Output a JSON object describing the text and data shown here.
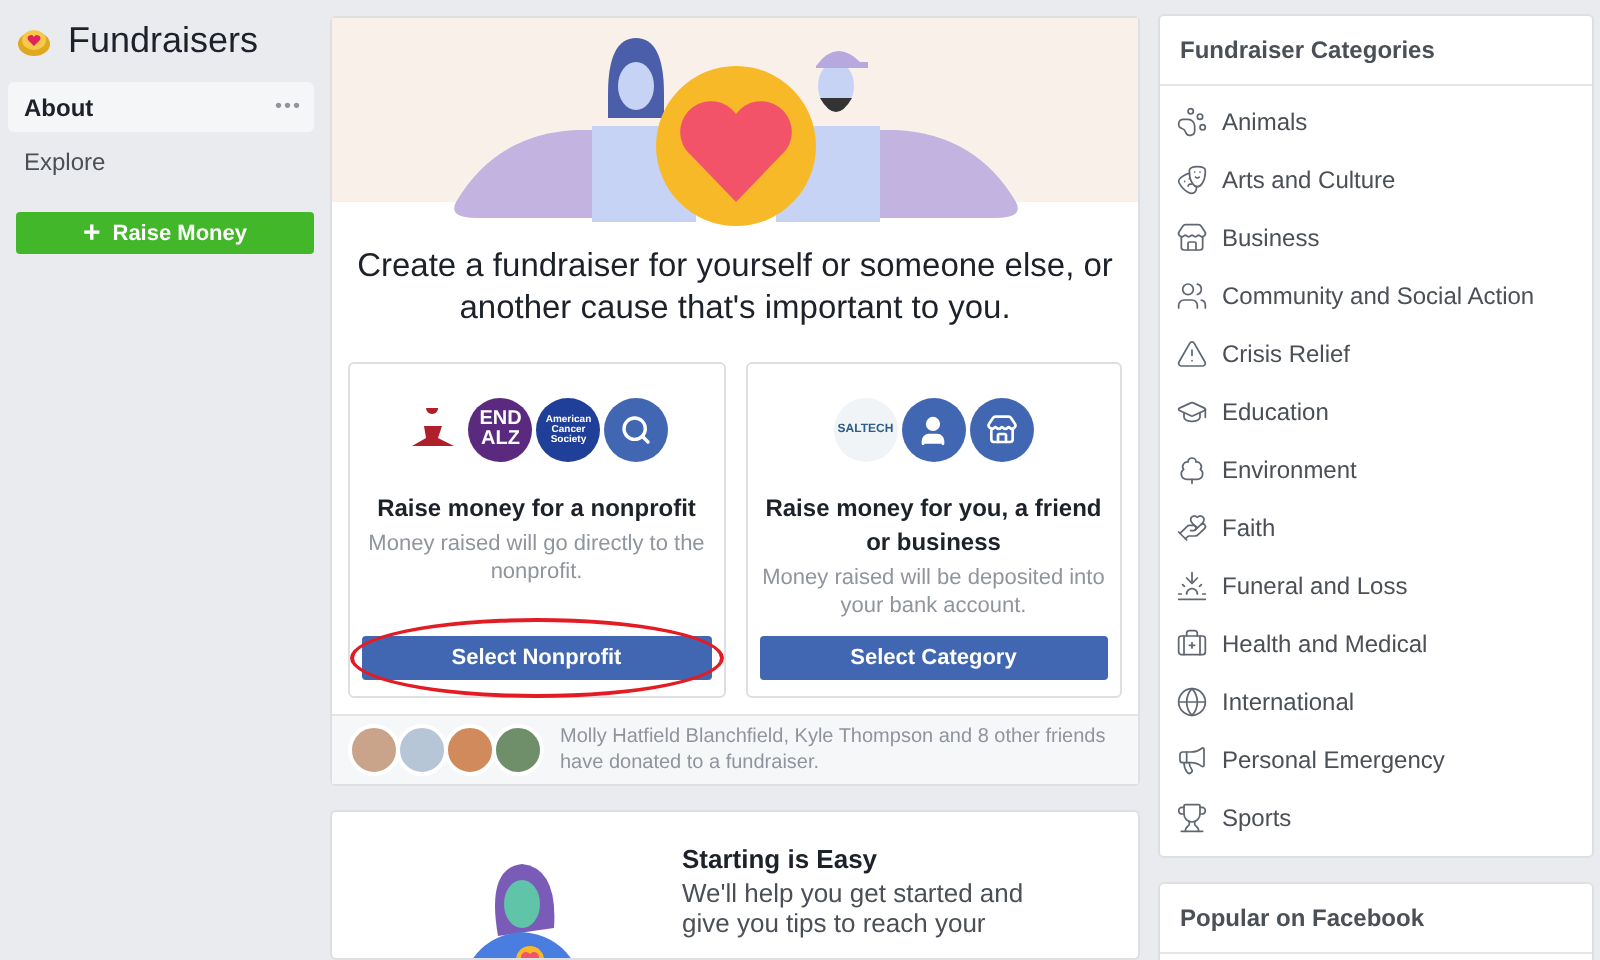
{
  "sidebar": {
    "title": "Fundraisers",
    "items": [
      {
        "label": "About",
        "selected": true,
        "more": "•••"
      },
      {
        "label": "Explore",
        "selected": false
      }
    ],
    "action": {
      "label": "Raise Money",
      "icon": "+"
    }
  },
  "intro": {
    "heading": "Create a fundraiser for yourself or someone else, or another cause that's important to you."
  },
  "options": [
    {
      "logos": [
        {
          "kind": "saint"
        },
        {
          "kind": "alz",
          "text": "END ALZ"
        },
        {
          "kind": "cancer",
          "text": "American Cancer Society"
        },
        {
          "kind": "search"
        }
      ],
      "title": "Raise money for a nonprofit",
      "description": "Money raised will go directly to the nonprofit.",
      "button": "Select Nonprofit",
      "highlighted": true
    },
    {
      "logos": [
        {
          "kind": "saltech",
          "text": "SALTECH"
        },
        {
          "kind": "person"
        },
        {
          "kind": "store"
        }
      ],
      "title": "Raise money for you, a friend or business",
      "description": "Money raised will be deposited into your bank account.",
      "button": "Select Category",
      "highlighted": false
    }
  ],
  "friends": {
    "avatars": [
      {
        "color": "#c9a48a"
      },
      {
        "color": "#b7c6d6"
      },
      {
        "color": "#d08a5c"
      },
      {
        "color": "#6f8f6a"
      }
    ],
    "text": "Molly Hatfield Blanchfield, Kyle Thompson and 8 other friends have donated to a fundraiser."
  },
  "starting": {
    "title": "Starting is Easy",
    "text": "We'll help you get started and give you tips to reach your"
  },
  "categories": {
    "title": "Fundraiser Categories",
    "items": [
      "Animals",
      "Arts and Culture",
      "Business",
      "Community and Social Action",
      "Crisis Relief",
      "Education",
      "Environment",
      "Faith",
      "Funeral and Loss",
      "Health and Medical",
      "International",
      "Personal Emergency",
      "Sports"
    ]
  },
  "popular": {
    "title": "Popular on Facebook"
  }
}
